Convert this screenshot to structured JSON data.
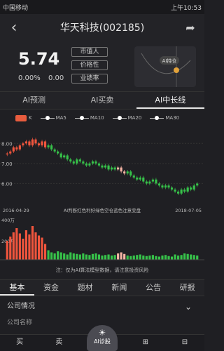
{
  "status": {
    "left": "中国移动",
    "right": "上午10:53"
  },
  "nav": {
    "title": "华天科技(002185)"
  },
  "quote": {
    "price": "5.74",
    "change": "0.00%",
    "change_abs": "0.00",
    "btns": [
      "市值人",
      "价格性",
      "业绩率"
    ]
  },
  "mini": {
    "label": "AI持仓"
  },
  "tabs1": [
    "AI预测",
    "AI买卖",
    "AI中长线"
  ],
  "legend": [
    "K",
    "MA5",
    "MA10",
    "MA20",
    "MA30"
  ],
  "chart_data": {
    "type": "bar",
    "ylim": [
      5.0,
      8.5
    ],
    "yticks": [
      "8.00",
      "7.00",
      "6.00"
    ],
    "xlabels": [
      "2016-04-29",
      "2018-07-05"
    ],
    "annotation": "AI判断红色利好绿色空仓蓝色注意变盘",
    "closes": [
      7.5,
      7.6,
      7.8,
      7.7,
      7.9,
      8.0,
      8.1,
      7.9,
      8.2,
      8.0,
      7.9,
      8.1,
      7.8,
      7.9,
      7.7,
      7.6,
      7.5,
      7.3,
      7.4,
      7.2,
      7.1,
      7.0,
      7.2,
      7.1,
      7.0,
      6.9,
      7.0,
      7.1,
      7.0,
      6.9,
      6.8,
      6.9,
      6.7,
      6.8,
      6.7,
      6.8,
      6.6,
      6.5,
      6.6,
      6.4,
      6.3,
      6.2,
      6.3,
      6.1,
      6.0,
      6.1,
      6.2,
      6.0,
      5.9,
      5.8,
      5.9,
      5.8,
      5.7,
      5.6,
      5.5,
      5.7,
      5.6,
      5.8,
      5.7,
      5.9,
      6.0
    ],
    "colors": [
      "r",
      "r",
      "r",
      "r",
      "r",
      "r",
      "r",
      "r",
      "r",
      "r",
      "r",
      "r",
      "r",
      "g",
      "g",
      "g",
      "g",
      "g",
      "g",
      "g",
      "g",
      "g",
      "g",
      "g",
      "g",
      "g",
      "g",
      "g",
      "g",
      "g",
      "g",
      "g",
      "g",
      "g",
      "g",
      "p",
      "p",
      "p",
      "g",
      "g",
      "g",
      "g",
      "g",
      "g",
      "g",
      "g",
      "g",
      "g",
      "g",
      "g",
      "g",
      "g",
      "g",
      "g",
      "g",
      "g",
      "g",
      "g",
      "g",
      "g",
      "g"
    ],
    "vol_label": "400万",
    "vol_mid": "200万",
    "volume": [
      180,
      220,
      260,
      300,
      250,
      200,
      280,
      240,
      320,
      260,
      230,
      210,
      150,
      90,
      70,
      60,
      80,
      70,
      60,
      50,
      70,
      60,
      55,
      50,
      60,
      50,
      45,
      55,
      60,
      50,
      40,
      45,
      50,
      40,
      45,
      60,
      70,
      55,
      40,
      35,
      40,
      45,
      50,
      40,
      35,
      40,
      45,
      35,
      30,
      40,
      45,
      35,
      30,
      50,
      40,
      45,
      60,
      55,
      50,
      45,
      40
    ],
    "legend_labels": []
  },
  "note": "注：仅为AI算法模型数据，请注意投资风险",
  "tabs2": [
    "基本",
    "资金",
    "题材",
    "新闻",
    "公告",
    "研报"
  ],
  "section": {
    "title": "公司情况",
    "company": "公司名称"
  },
  "bottom": {
    "buy": "买",
    "sell": "卖",
    "ai": "AI诊股",
    "add": "⊞",
    "minus": "⊟"
  }
}
